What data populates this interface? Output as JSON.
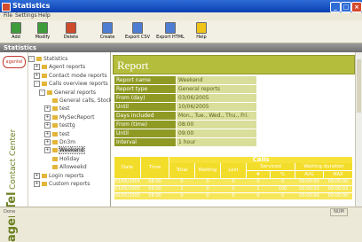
{
  "window": {
    "title": "Statistics"
  },
  "menu": [
    "File",
    "Settings",
    "Help"
  ],
  "toolbar": [
    {
      "label": "Add",
      "icon": "add-report-icon",
      "color": "#3e9d3a"
    },
    {
      "label": "Modify",
      "icon": "modify-icon",
      "color": "#3e9d3a"
    },
    {
      "label": "Delete",
      "icon": "delete-icon",
      "color": "#d04a2c"
    },
    {
      "label": "Create",
      "icon": "create-icon",
      "color": "#4e7ed3"
    },
    {
      "label": "Export CSV",
      "icon": "export-csv-icon",
      "color": "#4e7ed3"
    },
    {
      "label": "Export HTML",
      "icon": "export-html-icon",
      "color": "#4e7ed3"
    },
    {
      "label": "Help",
      "icon": "help-icon",
      "color": "#f0c419"
    }
  ],
  "section": {
    "title": "Statistics"
  },
  "brand": {
    "logo_text": "agentel",
    "name_bold": "agenTel",
    "name_rest": "Contact Center"
  },
  "tree": [
    {
      "level": 0,
      "label": "Statistics",
      "expander": "-"
    },
    {
      "level": 1,
      "label": "Agent reports",
      "expander": "+"
    },
    {
      "level": 1,
      "label": "Contact mode reports",
      "expander": "+"
    },
    {
      "level": 1,
      "label": "Calls overview reports",
      "expander": "-"
    },
    {
      "level": 2,
      "label": "General reports",
      "expander": "-"
    },
    {
      "level": 3,
      "label": "General calls, Stockholm",
      "expander": ""
    },
    {
      "level": 3,
      "label": "test",
      "expander": "+"
    },
    {
      "level": 3,
      "label": "MySecReport",
      "expander": "+"
    },
    {
      "level": 3,
      "label": "testtg",
      "expander": "+"
    },
    {
      "level": 3,
      "label": "test",
      "expander": "+"
    },
    {
      "level": 3,
      "label": "Dn3m",
      "expander": "+"
    },
    {
      "level": 3,
      "label": "Weekend",
      "expander": "+",
      "selected": true
    },
    {
      "level": 3,
      "label": "Holiday",
      "expander": ""
    },
    {
      "level": 3,
      "label": "Alloweekd",
      "expander": ""
    },
    {
      "level": 1,
      "label": "Login reports",
      "expander": "+"
    },
    {
      "level": 1,
      "label": "Custom reports",
      "expander": "+"
    }
  ],
  "report": {
    "title": "Report",
    "info": [
      {
        "key": "Report name",
        "value": "Weekend"
      },
      {
        "key": "Report type",
        "value": "General reports"
      },
      {
        "key": "From (day)",
        "value": "03/06/2005"
      },
      {
        "key": "Until",
        "value": "10/06/2005"
      },
      {
        "key": "Days included",
        "value": "Mon., Tue., Wed., Thu., Fri."
      },
      {
        "key": "From (time)",
        "value": "08:00"
      },
      {
        "key": "Until",
        "value": "09:00"
      },
      {
        "key": "Interval",
        "value": "1 hour"
      }
    ],
    "table": {
      "group": "Calls",
      "headers": {
        "date": "Date",
        "time": "Time",
        "total": "Total",
        "waiting": "Waiting",
        "lost": "Lost",
        "serviced": "Serviced",
        "waiting_duration": "Waiting duration"
      },
      "subheaders": {
        "serviced_n": "#",
        "serviced_pct": "%",
        "wd_avg": "AVG",
        "wd_max": "MAX"
      },
      "rows": [
        [
          "03/06/2005",
          "08:00",
          "0",
          "0",
          "0",
          "0",
          "0",
          "00:00:00",
          "00:00:00"
        ],
        [
          "03/06/2005",
          "09:00",
          "1",
          "0",
          "0",
          "1",
          "100",
          "00:00:03",
          "00:00:03"
        ],
        [
          "06/06/2005",
          "08:00",
          "0",
          "0",
          "0",
          "0",
          "0",
          "00:00:00",
          "00:00:00"
        ]
      ]
    }
  },
  "status": {
    "left": "Done",
    "num": "NUM"
  }
}
